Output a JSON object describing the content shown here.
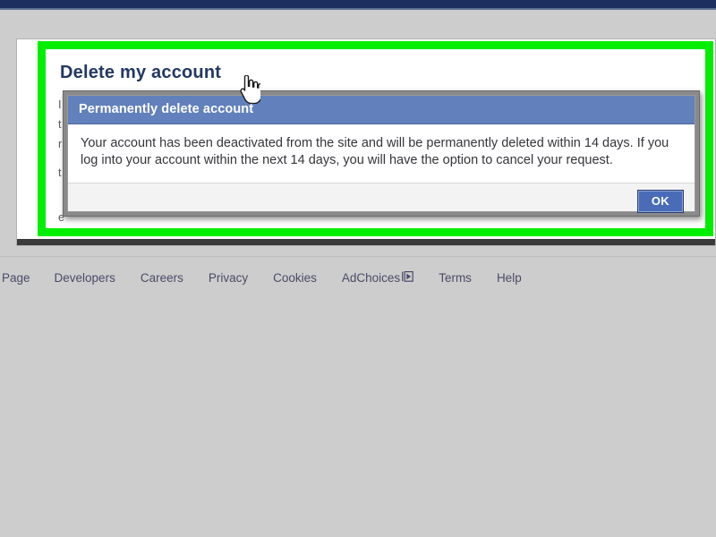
{
  "window": {
    "topbar_color": "#1d2f5e",
    "page_background": "#cdcdcd",
    "highlight_color": "#00ee00"
  },
  "page": {
    "heading": "Delete my account",
    "obscured_text_fragments": [
      "I",
      "t",
      "r",
      "t",
      "e"
    ]
  },
  "dialog": {
    "title": "Permanently delete account",
    "titlebar_color": "#6280bc",
    "message": "Your account has been deactivated from the site and will be permanently deleted within 14 days. If you log into your account within the next 14 days, you will have the option to cancel your request.",
    "ok_label": "OK",
    "ok_color": "#4a6cb8"
  },
  "cursor": {
    "type": "pointing-hand"
  },
  "footer": {
    "links": [
      {
        "label": "Page"
      },
      {
        "label": "Developers"
      },
      {
        "label": "Careers"
      },
      {
        "label": "Privacy"
      },
      {
        "label": "Cookies"
      },
      {
        "label": "AdChoices",
        "icon": "adchoices-triangle-icon"
      },
      {
        "label": "Terms"
      },
      {
        "label": "Help"
      }
    ]
  }
}
